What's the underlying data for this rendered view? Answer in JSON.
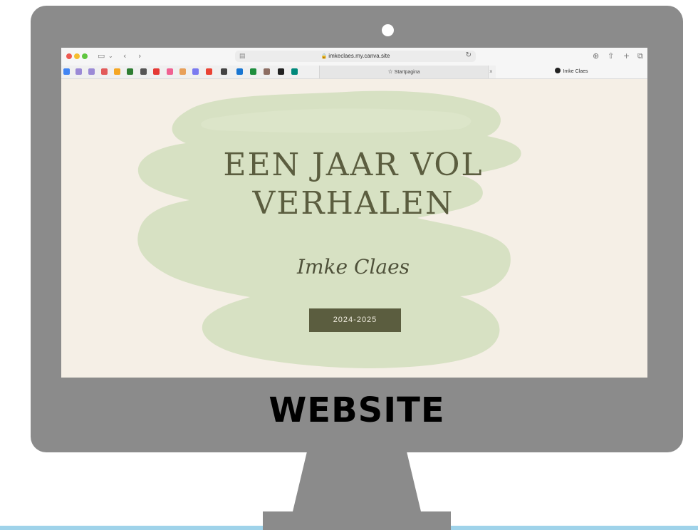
{
  "browser": {
    "url": "imkeclaes.my.canva.site",
    "tabs": [
      {
        "label": "Startpagina"
      },
      {
        "label": "Imke Claes"
      }
    ],
    "tab_close_glyph": "×",
    "toolbar_icons": [
      "sidebar-icon",
      "chevron-down-icon",
      "back-icon",
      "forward-icon",
      "download-icon",
      "share-icon",
      "new-tab-icon",
      "tab-overview-icon"
    ],
    "bookmark_colors": [
      "#4285f4",
      "#9b8ad6",
      "#9b8ad6",
      "#e25a5a",
      "#f5a623",
      "#2e7d32",
      "#555555",
      "#e53935",
      "#f06292",
      "#e8a05a",
      "#7a7af0",
      "#ea4335",
      "#444444",
      "#1976d2",
      "#1e8e3e",
      "#8d6e63",
      "#222222",
      "#00897b"
    ]
  },
  "page": {
    "title_line1": "EEN JAAR VOL",
    "title_line2": "VERHALEN",
    "author": "Imke Claes",
    "year_button": "2024-2025",
    "accent": "#5b5d3f",
    "background": "#f5efe6",
    "blob": "#d7e1c3"
  },
  "monitor": {
    "label": "WEBSITE",
    "color": "#8b8b8b"
  }
}
